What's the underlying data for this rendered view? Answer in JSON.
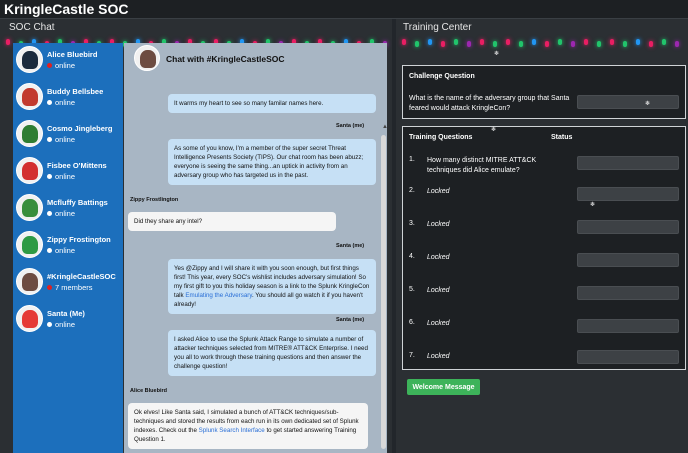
{
  "app": {
    "title": "KringleCastle SOC"
  },
  "left_header": "SOC Chat",
  "right_header": "Training Center",
  "contacts": [
    {
      "name": "Alice Bluebird",
      "status": "online",
      "dot": "#e02020"
    },
    {
      "name": "Buddy Bellsbee",
      "status": "online",
      "dot": "#ffffff"
    },
    {
      "name": "Cosmo Jingleberg",
      "status": "online",
      "dot": "#ffffff"
    },
    {
      "name": "Fisbee O'Mittens",
      "status": "online",
      "dot": "#ffffff"
    },
    {
      "name": "Mcfluffy Battings",
      "status": "online",
      "dot": "#ffffff"
    },
    {
      "name": "Zippy Frostington",
      "status": "online",
      "dot": "#ffffff"
    },
    {
      "name": "#KringleCastleSOC",
      "status": "7 members",
      "dot": "#e02020"
    },
    {
      "name": "Santa (Me)",
      "status": "online",
      "dot": "#ffffff"
    }
  ],
  "chat": {
    "title": "Chat with #KringleCastleSOC",
    "messages": [
      {
        "sender": "",
        "text": "It warms my heart to see so many familar names here."
      },
      {
        "sender": "Santa (me)",
        "text": "As some of you know, I'm a member of the super secret Threat Intelligence Presents Society (TIPS). Our chat room has been abuzz; everyone is seeing the same thing...an uptick in activity from an adversary group who has targeted us in the past."
      },
      {
        "sender": "Zippy Frostlington",
        "text": "Did they share any intel?"
      },
      {
        "sender": "Santa (me)",
        "text": "Yes @Zippy and I will share it with you soon enough, but first things first! This year, every SOC's wishlist includes adversary simulation! So my first gift to you this holiday season is a link to the Splunk KringleCon talk ",
        "link": "Emulating the Adversary",
        "tail": ". You should all go watch it if you haven't already!"
      },
      {
        "sender": "Santa (me)",
        "text": "I asked Alice to use the Splunk Attack Range to simulate a number of attacker techniques selected from MITRE® ATT&CK Enterprise. I need you all to work through these training questions and then answer the challenge question!"
      },
      {
        "sender": "Alice Bluebird",
        "text": "Ok elves! Like Santa said, I simulated a bunch of ATT&CK techniques/sub-techniques and stored the results from each run in its own dedicated set of Splunk indexes. Check out the ",
        "link": "Splunk Search Interface",
        "tail": " to get started answering Training Question 1."
      }
    ]
  },
  "challenge": {
    "title": "Challenge Question",
    "question": "What is the name of the adversary group that Santa feared would attack KringleCon?"
  },
  "training": {
    "col_questions": "Training Questions",
    "col_status": "Status",
    "items": [
      {
        "num": "1.",
        "text": "How many distinct MITRE ATT&CK techniques did Alice emulate?",
        "locked": false
      },
      {
        "num": "2.",
        "text": "Locked",
        "locked": true
      },
      {
        "num": "3.",
        "text": "Locked",
        "locked": true
      },
      {
        "num": "4.",
        "text": "Locked",
        "locked": true
      },
      {
        "num": "5.",
        "text": "Locked",
        "locked": true
      },
      {
        "num": "6.",
        "text": "Locked",
        "locked": true
      },
      {
        "num": "7.",
        "text": "Locked",
        "locked": true
      }
    ]
  },
  "welcome_button": "Welcome Message"
}
